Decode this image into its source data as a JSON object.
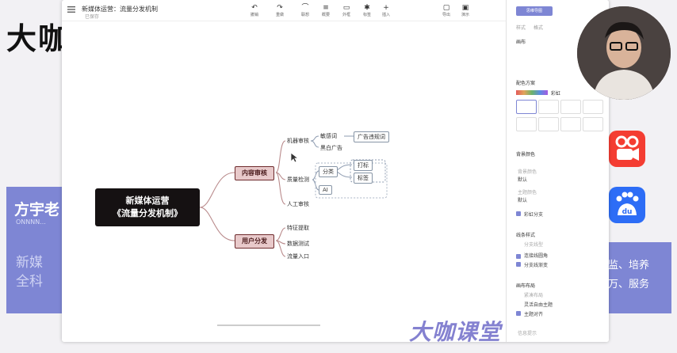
{
  "background": {
    "big_title": "大咖",
    "left_panel": {
      "name": "方宇老",
      "sub": "ONNNN...",
      "faded": "新媒\n全科"
    },
    "right_panel": {
      "text": "监、培养\n万、服务"
    },
    "du_label": "du"
  },
  "window": {
    "doc_title": "新媒体运营：流量分发机制",
    "doc_subtitle": "已保存",
    "toolbar": [
      {
        "icon": "↶",
        "label": "撤销"
      },
      {
        "icon": "↷",
        "label": "重做"
      },
      {
        "icon": "⌒",
        "label": "联想"
      },
      {
        "icon": "≡",
        "label": "概要"
      },
      {
        "icon": "▭",
        "label": "外框"
      },
      {
        "icon": "✱",
        "label": "标签"
      },
      {
        "icon": "+",
        "label": "插入"
      },
      {
        "icon": "▢",
        "label": "导出"
      },
      {
        "icon": "▣",
        "label": "演示"
      }
    ],
    "mindmap": {
      "root_line1": "新媒体运营",
      "root_line2": "《流量分发机制》",
      "branch1": "内容审核",
      "branch2": "用户分发",
      "b1_children": [
        "机器审核",
        "质量检测",
        "人工审核"
      ],
      "b1_c1_children": [
        "敏感词",
        "黑白广告"
      ],
      "b1_c1_c1_child": "广告违规词",
      "b1_c2_children": [
        "分类",
        "AI"
      ],
      "b1_c2_c1_children": [
        "打标",
        "标签"
      ],
      "b2_children": [
        "特征提取",
        "数据测试",
        "流量入口"
      ]
    },
    "side": {
      "button": "思维导图",
      "tabs": [
        "样式",
        "格式"
      ],
      "section1": "画布",
      "section2": "配色方案",
      "theme_color_name": "彩虹",
      "section3": "背景颜色",
      "field1_label": "背景颜色",
      "field1_value": "默认",
      "field2_label": "主题颜色",
      "field2_value": "默认",
      "rainbow_branch": "彩虹分支",
      "section4": "线条样式",
      "line_opt_grey": "分支线型",
      "line_opt1": "连接线圆角",
      "line_opt2": "分支线渐变",
      "section5": "画布布局",
      "layout_grey": "紧凑布局",
      "layout1": "灵活自由主题",
      "layout2": "主题对齐",
      "footer": "信息提示"
    }
  },
  "watermark": "大咖课堂",
  "colors": {
    "accent": "#7e86d4",
    "root": "#151112",
    "branch_fill": "#e8c9ca",
    "branch_line": "#6e2b2d",
    "link": "#b98a8b"
  }
}
